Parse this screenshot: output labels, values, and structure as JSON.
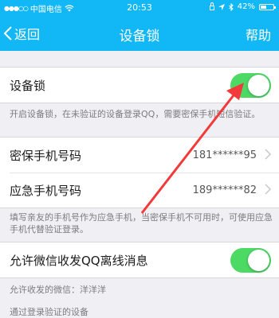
{
  "status_bar": {
    "carrier": "中国电信",
    "time": "20:53",
    "battery_percent": "42%",
    "icons": [
      "signal-dots-icon",
      "wifi-icon",
      "alarm-icon",
      "location-icon",
      "bluetooth-icon",
      "battery-icon"
    ]
  },
  "nav": {
    "back_label": "返回",
    "title": "设备锁",
    "help_label": "帮助",
    "accent_color": "#12b7f5"
  },
  "device_lock": {
    "label": "设备锁",
    "enabled": true,
    "description": "开启设备锁，在未验证的设备登录QQ，需要密保手机短信验证。"
  },
  "phones": {
    "secure_label": "密保手机号码",
    "secure_value": "181******95",
    "emergency_label": "应急手机号码",
    "emergency_value": "189******82",
    "description": "填写亲友的手机号作为应急手机，当密保手机不可用时，可使用应急手机代替验证登录。"
  },
  "wechat": {
    "label": "允许微信收发QQ离线消息",
    "enabled": true,
    "allowed_text": "允许收发的微信：洋洋洋"
  },
  "verified_devices_header": "通过登录验证的设备",
  "toggle_on_color": "#4cd964"
}
